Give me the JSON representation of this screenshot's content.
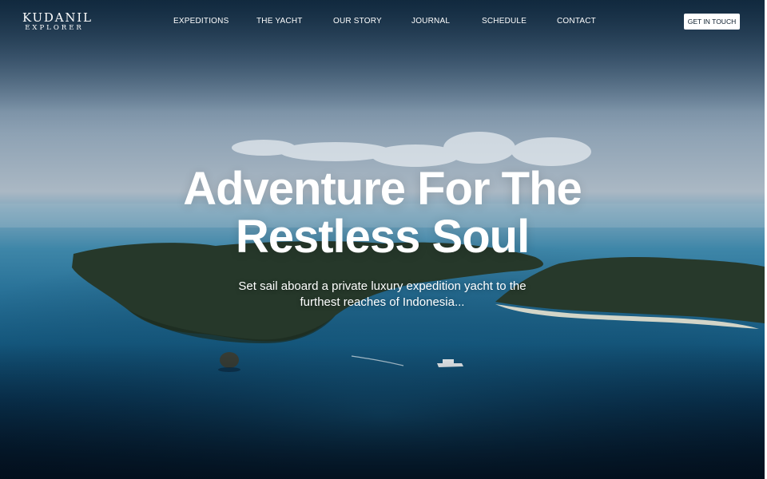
{
  "brand": {
    "name_line1": "KUDANIL",
    "name_line2": "EXPLORER"
  },
  "nav": {
    "items": [
      {
        "label": "EXPEDITIONS"
      },
      {
        "label": "THE YACHT"
      },
      {
        "label": "OUR STORY"
      },
      {
        "label": "JOURNAL"
      },
      {
        "label": "SCHEDULE"
      },
      {
        "label": "CONTACT"
      }
    ],
    "cta_label": "GET IN TOUCH"
  },
  "hero": {
    "headline_line1": "Adventure For The",
    "headline_line2": "Restless Soul",
    "subhead_line1": "Set sail aboard a private luxury expedition yacht to the",
    "subhead_line2": "furthest reaches of Indonesia..."
  },
  "colors": {
    "cta_background": "#ffffff",
    "cta_text": "#0b1d2c",
    "text": "#ffffff"
  }
}
